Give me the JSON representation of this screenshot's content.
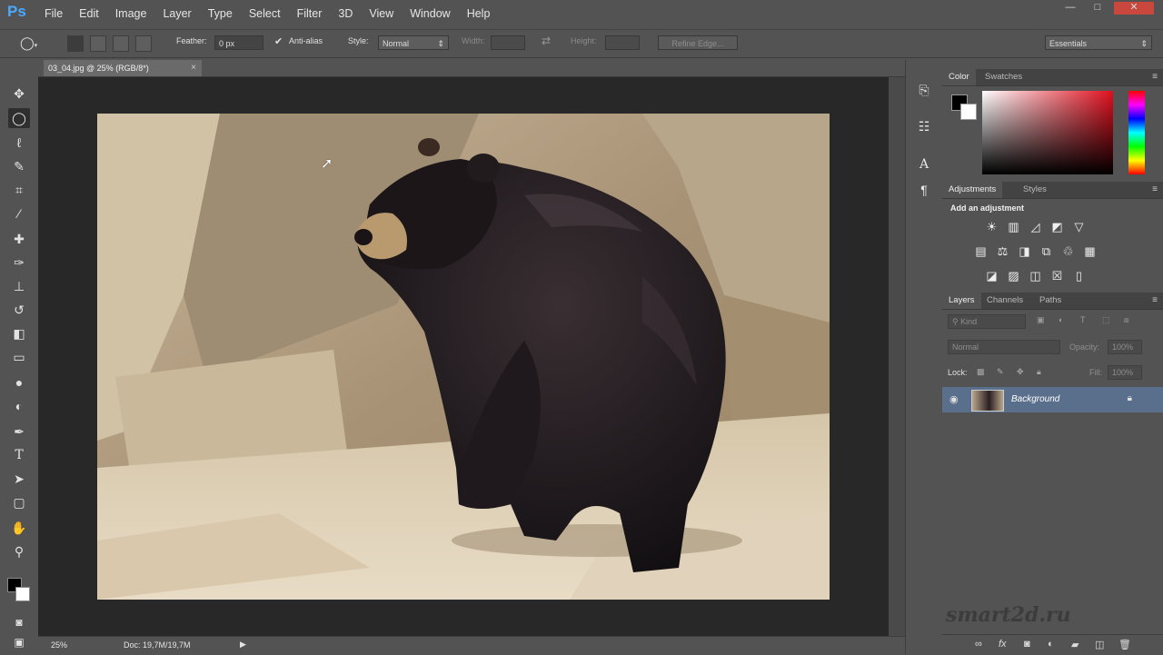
{
  "app": {
    "logo": "Ps",
    "menu": [
      "File",
      "Edit",
      "Image",
      "Layer",
      "Type",
      "Select",
      "Filter",
      "3D",
      "View",
      "Window",
      "Help"
    ],
    "window_controls": [
      "—",
      "□",
      "✕"
    ]
  },
  "options_bar": {
    "feather_label": "Feather:",
    "feather_value": "0 px",
    "antialias_label": "Anti-alias",
    "style_label": "Style:",
    "style_value": "Normal",
    "width_label": "Width:",
    "height_label": "Height:",
    "refine_edge_label": "Refine Edge...",
    "workspace_value": "Essentials"
  },
  "document": {
    "tab_title": "03_04.jpg @ 25% (RGB/8*)",
    "close_glyph": "×",
    "zoom": "25%",
    "doc_size": "Doc: 19,7M/19,7M"
  },
  "color_panel": {
    "tabs": [
      "Color",
      "Swatches"
    ],
    "foreground": "#000000",
    "background": "#ffffff"
  },
  "adjustments_panel": {
    "tabs": [
      "Adjustments",
      "Styles"
    ],
    "heading": "Add an adjustment"
  },
  "layers_panel": {
    "tabs": [
      "Layers",
      "Channels",
      "Paths"
    ],
    "filter_kind": "Kind",
    "blend_mode": "Normal",
    "opacity_label": "Opacity:",
    "opacity_value": "100%",
    "lock_label": "Lock:",
    "fill_label": "Fill:",
    "fill_value": "100%",
    "layers": [
      {
        "name": "Background",
        "visible": true,
        "locked": true
      }
    ]
  },
  "watermark": "smart2d.ru",
  "icons": {
    "toolbar": [
      "move-tool-icon",
      "elliptical-marquee-icon",
      "lasso-icon",
      "quick-selection-icon",
      "crop-icon",
      "eyedropper-icon",
      "spot-healing-icon",
      "brush-icon",
      "clone-stamp-icon",
      "history-brush-icon",
      "eraser-icon",
      "gradient-icon",
      "blur-icon",
      "dodge-icon",
      "pen-icon",
      "type-tool-icon",
      "path-selection-icon",
      "rectangle-tool-icon",
      "hand-icon",
      "zoom-icon",
      "quick-mask-icon",
      "screen-mode-icon"
    ],
    "accent": "#4aa8ff",
    "selected_layer": "#5a6f8c"
  }
}
